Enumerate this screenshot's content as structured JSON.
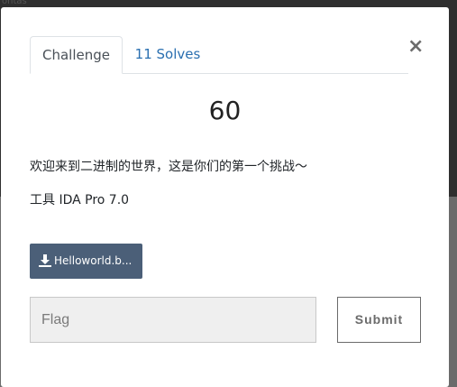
{
  "backdrop": {
    "partial_text": "ontas"
  },
  "modal": {
    "tabs": [
      {
        "label": "Challenge",
        "active": true
      },
      {
        "label": "11 Solves",
        "active": false
      }
    ],
    "close_symbol": "×",
    "points": "60",
    "description": "欢迎来到二进制的世界，这是你们的第一个挑战～",
    "tool_line": "工具 IDA Pro 7.0",
    "file": {
      "icon": "download-icon",
      "label": "Helloworld.b..."
    },
    "flag_input": {
      "placeholder": "Flag",
      "value": ""
    },
    "submit_label": "Submit"
  },
  "colors": {
    "backdrop": "#2f2f2f",
    "tab_link": "#2a6fb0",
    "file_button": "#4b5f78",
    "input_bg": "#efefef"
  }
}
